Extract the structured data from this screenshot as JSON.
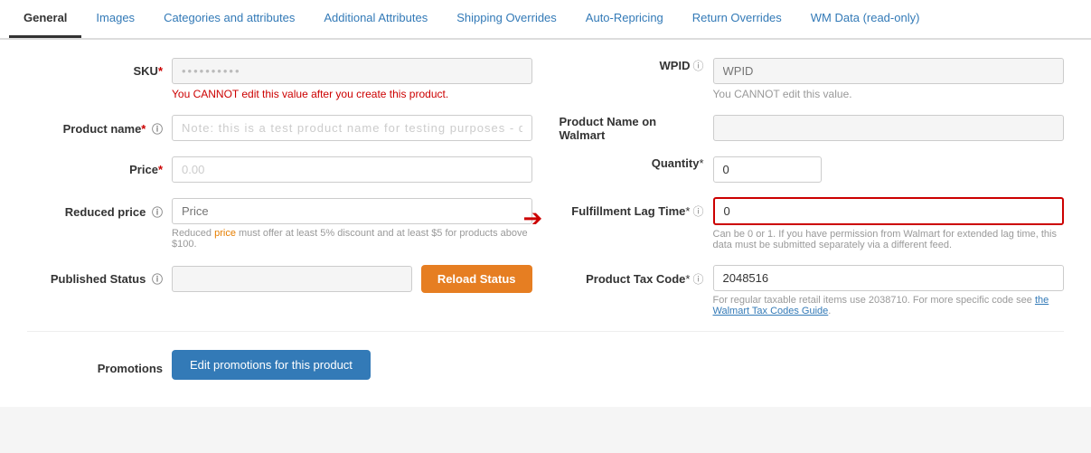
{
  "tabs": [
    {
      "id": "general",
      "label": "General",
      "active": true,
      "link": false
    },
    {
      "id": "images",
      "label": "Images",
      "active": false,
      "link": true
    },
    {
      "id": "categories",
      "label": "Categories and attributes",
      "active": false,
      "link": true
    },
    {
      "id": "additional",
      "label": "Additional Attributes",
      "active": false,
      "link": true
    },
    {
      "id": "shipping",
      "label": "Shipping Overrides",
      "active": false,
      "link": true
    },
    {
      "id": "repricing",
      "label": "Auto-Repricing",
      "active": false,
      "link": true
    },
    {
      "id": "returns",
      "label": "Return Overrides",
      "active": false,
      "link": true
    },
    {
      "id": "wmdata",
      "label": "WM Data (read-only)",
      "active": false,
      "link": true
    }
  ],
  "fields": {
    "sku": {
      "label": "SKU",
      "required": true,
      "value": "",
      "placeholder": "",
      "hint": "You CANNOT edit this value after you create this product.",
      "disabled": false
    },
    "wpid": {
      "label": "WPID",
      "placeholder": "WPID",
      "hint": "You CANNOT edit this value.",
      "disabled": true
    },
    "product_name": {
      "label": "Product name",
      "required": true,
      "value": "",
      "disabled": false
    },
    "product_name_walmart": {
      "label": "Product Name on Walmart",
      "value": "",
      "disabled": true
    },
    "price": {
      "label": "Price",
      "required": true,
      "value": "",
      "disabled": false
    },
    "quantity": {
      "label": "Quantity",
      "required": true,
      "value": "0",
      "disabled": false
    },
    "reduced_price": {
      "label": "Reduced price",
      "placeholder": "Price",
      "hint1": "Reduced price must offer at least 5% discount and at least $5 for products above $100.",
      "disabled": false
    },
    "fulfillment_lag": {
      "label": "Fulfillment Lag Time",
      "required": true,
      "value": "0",
      "hint": "Can be 0 or 1. If you have permission from Walmart for extended lag time, this data must be submitted separately via a different feed.",
      "highlighted": true
    },
    "published_status": {
      "label": "Published Status",
      "value": "",
      "disabled": true
    },
    "reload_status_btn": "Reload Status",
    "product_tax_code": {
      "label": "Product Tax Code",
      "required": true,
      "value": "2048516",
      "hint": "For regular taxable retail items use 2038710. For more specific code see the",
      "link_text": "Walmart Tax Codes Guide",
      "hint2": "."
    }
  },
  "promotions": {
    "label": "Promotions",
    "button_label": "Edit promotions for this product"
  }
}
